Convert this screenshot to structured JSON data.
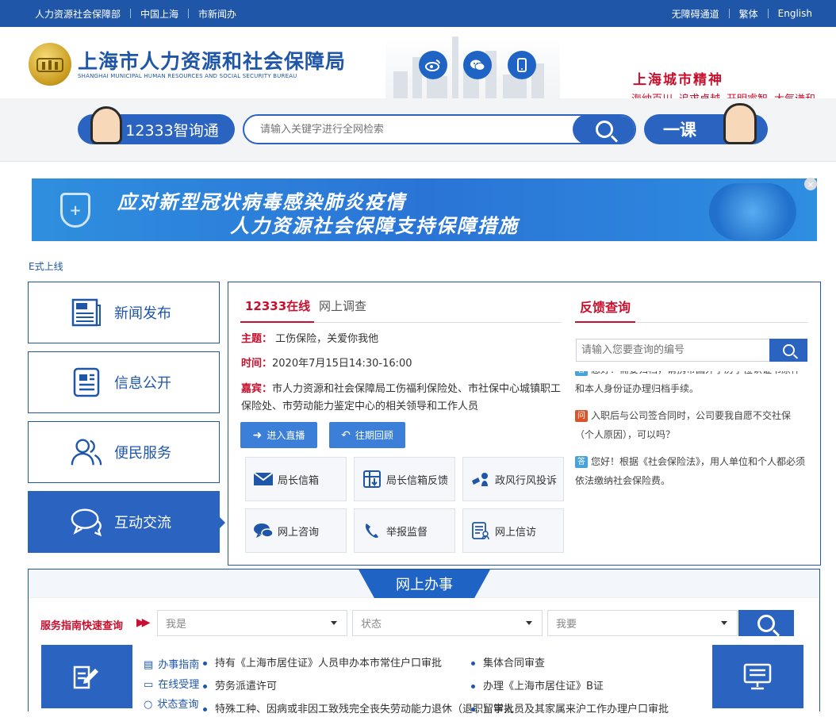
{
  "topbar": {
    "left_links": [
      "人力资源社会保障部",
      "中国上海",
      "市新闻办"
    ],
    "right_links": [
      "无障碍通道",
      "繁体",
      "English"
    ]
  },
  "header": {
    "site_title_cn": "上海市人力资源和社会保障局",
    "site_title_en": "SHANGHAI MUNICIPAL HUMAN RESOURCES AND SOCIAL SECURITY BUREAU",
    "social_icons": [
      "weibo-icon",
      "wechat-icon",
      "mobile-icon"
    ],
    "spirit_title": "上海城市精神",
    "spirit_words": [
      "海纳百川",
      "追求卓越",
      "开明睿智",
      "大气谦和"
    ]
  },
  "search": {
    "left_button": "12333智询通",
    "placeholder": "请输入关键字进行全网检索",
    "right_button": "一课"
  },
  "banner": {
    "line1": "应对新型冠状病毒感染肺炎疫情",
    "line2": "人力资源社会保障支持保障措施"
  },
  "marquee": "E式上线",
  "nav": {
    "items": [
      {
        "label": "新闻发布",
        "icon": "news-icon"
      },
      {
        "label": "信息公开",
        "icon": "document-icon"
      },
      {
        "label": "便民服务",
        "icon": "people-icon"
      },
      {
        "label": "互动交流",
        "icon": "chat-icon"
      }
    ]
  },
  "online": {
    "tab_active": "12333在线",
    "tab_inactive": "网上调查",
    "topic_label": "主题：",
    "topic_value": "工伤保险，关爱你我他",
    "time_label": "时间：",
    "time_value": "2020年7月15日14:30-16:00",
    "guest_label": "嘉宾：",
    "guest_value": "市人力资源和社会保障局工伤福利保险处、市社保中心城镇职工保险处、市劳动能力鉴定中心的相关领导和工作人员",
    "btn_live": "进入直播",
    "btn_review": "往期回顾",
    "tiles": [
      "局长信箱",
      "局长信箱反馈",
      "政风行风投诉",
      "网上咨询",
      "举报监督",
      "网上信访"
    ]
  },
  "feedback": {
    "title": "反馈查询",
    "placeholder": "请输入您要查询的编号",
    "items": [
      {
        "tag": "答",
        "type": "a",
        "text": "您好！需要归档，请携带国外学历学位认证书原件和本人身份证办理归档手续。"
      },
      {
        "tag": "问",
        "type": "w",
        "text": "入职后与公司签合同时，公司要我自愿不交社保（个人原因），可以吗？"
      },
      {
        "tag": "答",
        "type": "a",
        "text": "您好！根据《社会保险法》，用人单位和个人都必须依法缴纳社会保险费。"
      }
    ]
  },
  "services": {
    "title": "网上办事",
    "query_label": "服务指南快速查询",
    "select1": "我是",
    "select2": "状态",
    "select3": "我要",
    "side_links": [
      "办事指南",
      "在线受理",
      "状态查询"
    ],
    "list_left": [
      "持有《上海市居住证》人员申办本市常住户口审批",
      "劳务派遣许可",
      "特殊工种、因病或非因工致残完全丧失劳动能力退休（退职）审批"
    ],
    "list_right": [
      "集体合同审查",
      "办理《上海市居住证》B证",
      "留学人员及其家属来沪工作办理户口审批"
    ]
  },
  "colors": {
    "primary": "#1f56a8",
    "accent": "#c8102e",
    "button": "#2a63c0"
  }
}
